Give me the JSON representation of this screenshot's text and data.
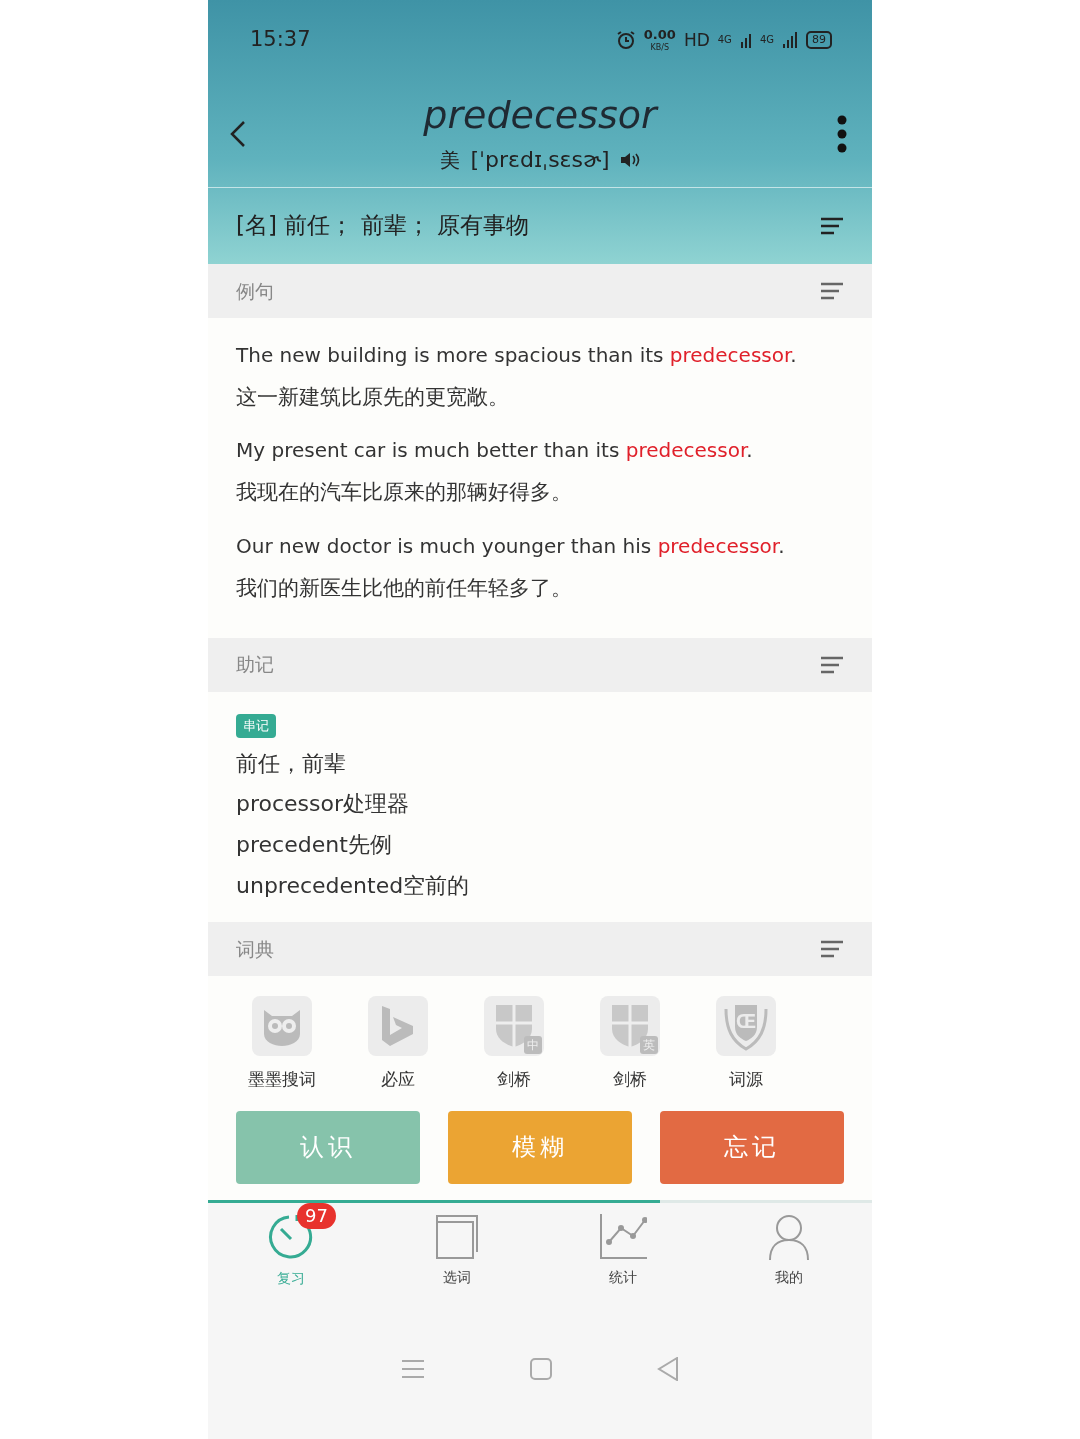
{
  "status_bar": {
    "time": "15:37",
    "speed_value": "0.00",
    "speed_unit": "KB/S",
    "hd": "HD",
    "network_1": "4G",
    "network_2": "4G",
    "battery": "89"
  },
  "header": {
    "word": "predecessor",
    "accent": "美",
    "phonetic": "[ˈprɛdɪˌsɛsɚ]"
  },
  "definition": "[名] 前任； 前辈； 原有事物",
  "examples": {
    "title": "例句",
    "items": [
      {
        "before": "The new building is more spacious than its ",
        "highlight": "predecessor",
        "after": ".",
        "translation": "这一新建筑比原先的更宽敞。"
      },
      {
        "before": "My present car is much better than its ",
        "highlight": "predecessor",
        "after": ".",
        "translation": "我现在的汽车比原来的那辆好得多。"
      },
      {
        "before": "Our new doctor is much younger than his ",
        "highlight": "predecessor",
        "after": ".",
        "translation": "我们的新医生比他的前任年轻多了。"
      }
    ]
  },
  "mnemonic": {
    "title": "助记",
    "tag": "串记",
    "lines": [
      "前任，前辈",
      "processor处理器",
      "precedent先例",
      "unprecedented空前的"
    ]
  },
  "dictionaries": {
    "title": "词典",
    "items": [
      {
        "kind": "owl",
        "label": "墨墨搜词"
      },
      {
        "kind": "bing",
        "label": "必应"
      },
      {
        "kind": "shield",
        "badge": "中",
        "label": "剑桥"
      },
      {
        "kind": "shield",
        "badge": "英",
        "label": "剑桥"
      },
      {
        "kind": "crest",
        "mark": "Œ",
        "label": "词源"
      }
    ]
  },
  "answer_buttons": [
    {
      "kind": "know",
      "label": "认识"
    },
    {
      "kind": "vague",
      "label": "模糊"
    },
    {
      "kind": "forget",
      "label": "忘记"
    }
  ],
  "progress": {
    "level": 0.68
  },
  "tabs": [
    {
      "kind": "review",
      "label": "复习",
      "badge": "97",
      "selected": true
    },
    {
      "kind": "book",
      "label": "选词",
      "selected": false
    },
    {
      "kind": "stats",
      "label": "统计",
      "selected": false
    },
    {
      "kind": "user",
      "label": "我的",
      "selected": false
    }
  ]
}
